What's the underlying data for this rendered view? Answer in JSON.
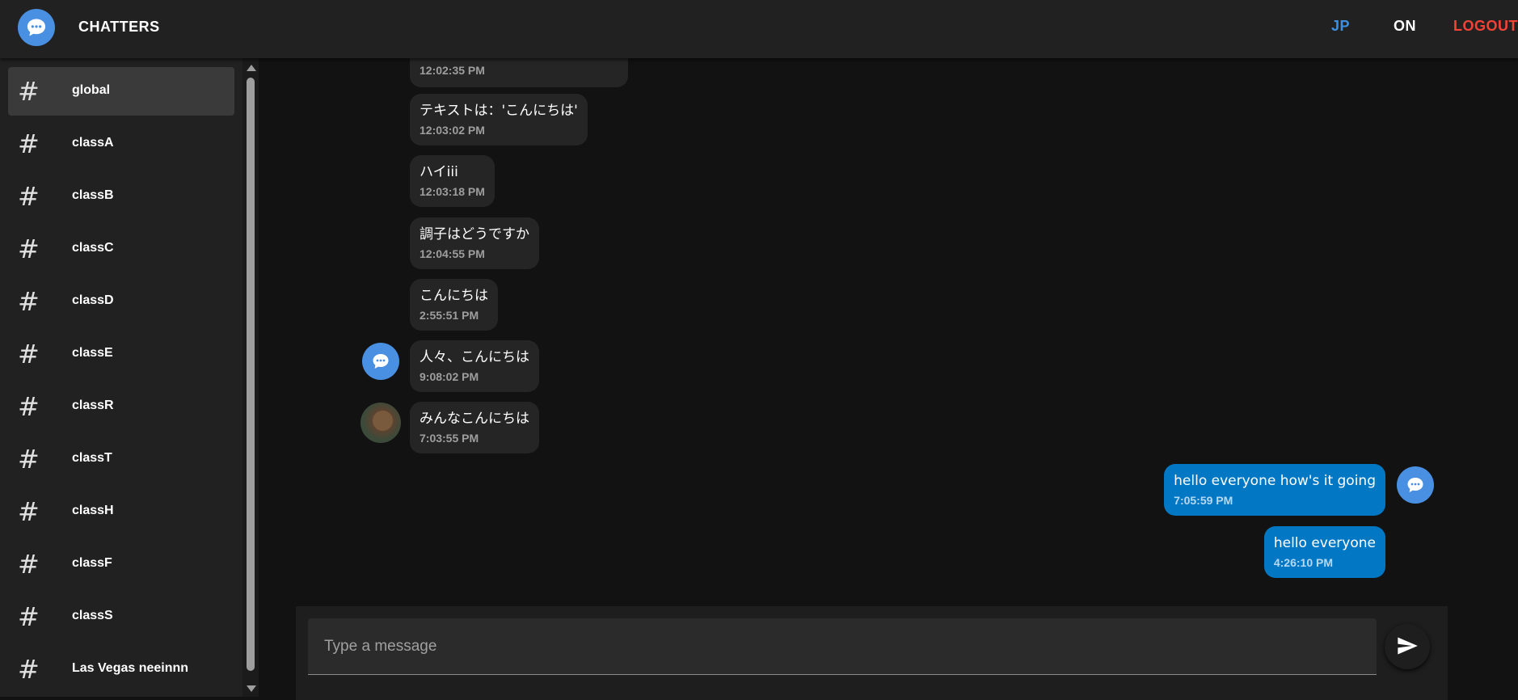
{
  "app": {
    "title": "CHATTERS",
    "logo_icon": "chat-bubble-icon"
  },
  "nav": {
    "language": "JP",
    "toggle": "ON",
    "logout": "LOGOUT"
  },
  "colors": {
    "accent": "#4a90e2",
    "language": "#3d8fe0",
    "logout": "#f44336",
    "outgoing_bubble": "#0278c5"
  },
  "channels": [
    {
      "label": "global",
      "active": true
    },
    {
      "label": "classA",
      "active": false
    },
    {
      "label": "classB",
      "active": false
    },
    {
      "label": "classC",
      "active": false
    },
    {
      "label": "classD",
      "active": false
    },
    {
      "label": "classE",
      "active": false
    },
    {
      "label": "classR",
      "active": false
    },
    {
      "label": "classT",
      "active": false
    },
    {
      "label": "classH",
      "active": false
    },
    {
      "label": "classF",
      "active": false
    },
    {
      "label": "classS",
      "active": false
    },
    {
      "label": "Las Vegas neeinnn",
      "active": false
    }
  ],
  "channel_icon": "hash-icon",
  "messages": [
    {
      "text": "",
      "time": "12:02:35 PM",
      "direction": "in",
      "avatar": null
    },
    {
      "text": "テキストは：'こんにちは'",
      "time": "12:03:02 PM",
      "direction": "in",
      "avatar": null
    },
    {
      "text": "ハイiii",
      "time": "12:03:18 PM",
      "direction": "in",
      "avatar": null
    },
    {
      "text": "調子はどうですか",
      "time": "12:04:55 PM",
      "direction": "in",
      "avatar": null
    },
    {
      "text": "こんにちは",
      "time": "2:55:51 PM",
      "direction": "in",
      "avatar": null
    },
    {
      "text": "人々、こんにちは",
      "time": "9:08:02 PM",
      "direction": "in",
      "avatar": "chat-bubble-icon"
    },
    {
      "text": "みんなこんにちは",
      "time": "7:03:55 PM",
      "direction": "in",
      "avatar": "dog-photo"
    },
    {
      "text": "hello everyone how's it going",
      "time": "7:05:59 PM",
      "direction": "out",
      "avatar": "chat-bubble-icon"
    },
    {
      "text": "hello everyone",
      "time": "4:26:10 PM",
      "direction": "out",
      "avatar": null
    }
  ],
  "composer": {
    "placeholder": "Type a message",
    "value": "",
    "send_icon": "send-icon"
  }
}
